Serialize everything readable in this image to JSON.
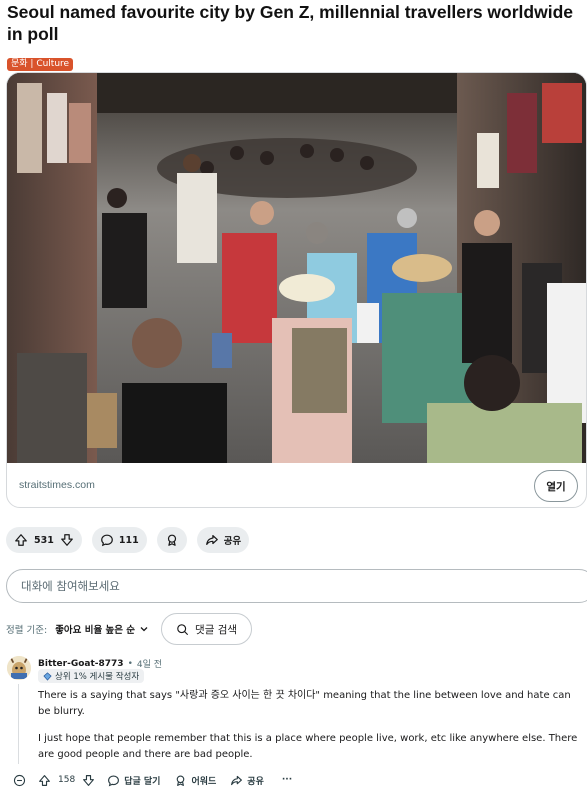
{
  "post": {
    "title": "Seoul named favourite city by Gen Z, millennial travellers worldwide in poll",
    "flair": "문화 | Culture",
    "link_domain": "straitstimes.com",
    "open_label": "열기"
  },
  "actions": {
    "upvotes": "531",
    "comments": "111",
    "share_label": "공유"
  },
  "comment_input": {
    "placeholder": "대화에 참여해보세요"
  },
  "sort": {
    "label": "정렬 기준:",
    "value": "좋아요 비율 높은 순",
    "search_label": "댓글 검색"
  },
  "comment": {
    "author": "Bitter-Goat-8773",
    "separator": "•",
    "time": "4일 전",
    "badge": "상위 1% 게시물 작성자",
    "paragraph_1": "There is a saying that says \"사랑과 증오 사이는 한 끗 차이다\" meaning that the line between love and hate can be blurry.",
    "paragraph_2": "I just hope that people remember that this is a place where people live, work, etc like anywhere else. There are good people and there are bad people.",
    "score": "158",
    "reply_label": "답글 달기",
    "award_label": "어워드",
    "share_label": "공유",
    "more_label": "···"
  },
  "icons": {
    "upvote": "arrow-up-icon",
    "downvote": "arrow-down-icon",
    "comment": "speech-bubble-icon",
    "award": "award-icon",
    "share": "share-arrow-icon",
    "search": "search-icon",
    "chevron": "chevron-down-icon",
    "collapse": "minus-circle-icon"
  },
  "colors": {
    "flair_bg": "#d9532b",
    "pill_bg": "#eaedef",
    "text": "#1a1a1b",
    "muted": "#576f76"
  }
}
